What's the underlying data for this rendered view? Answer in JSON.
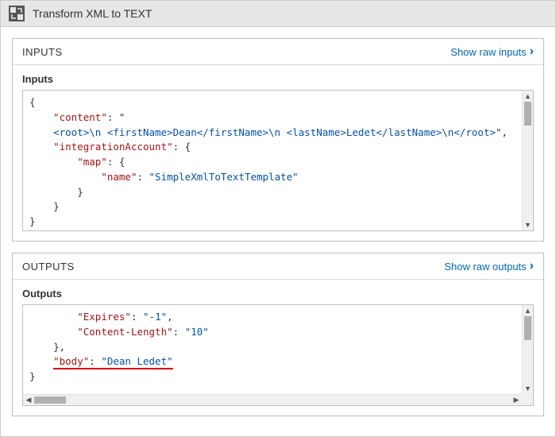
{
  "window": {
    "title": "Transform XML to TEXT"
  },
  "inputs_panel": {
    "heading": "INPUTS",
    "show_raw": "Show raw inputs",
    "sub_label": "Inputs",
    "json": {
      "content_key": "\"content\"",
      "content_val": "<root>\\n <firstName>Dean</firstName>\\n <lastName>Ledet</lastName>\\n</root>",
      "integration_key": "\"integrationAccount\"",
      "map_key": "\"map\"",
      "name_key": "\"name\"",
      "name_val": "\"SimpleXmlToTextTemplate\""
    }
  },
  "outputs_panel": {
    "heading": "OUTPUTS",
    "show_raw": "Show raw outputs",
    "sub_label": "Outputs",
    "json": {
      "expires_key": "\"Expires\"",
      "expires_val": "\"-1\"",
      "contentlength_key": "\"Content-Length\"",
      "contentlength_val": "\"10\"",
      "body_key": "\"body\"",
      "body_val": "\"Dean Ledet\""
    }
  }
}
